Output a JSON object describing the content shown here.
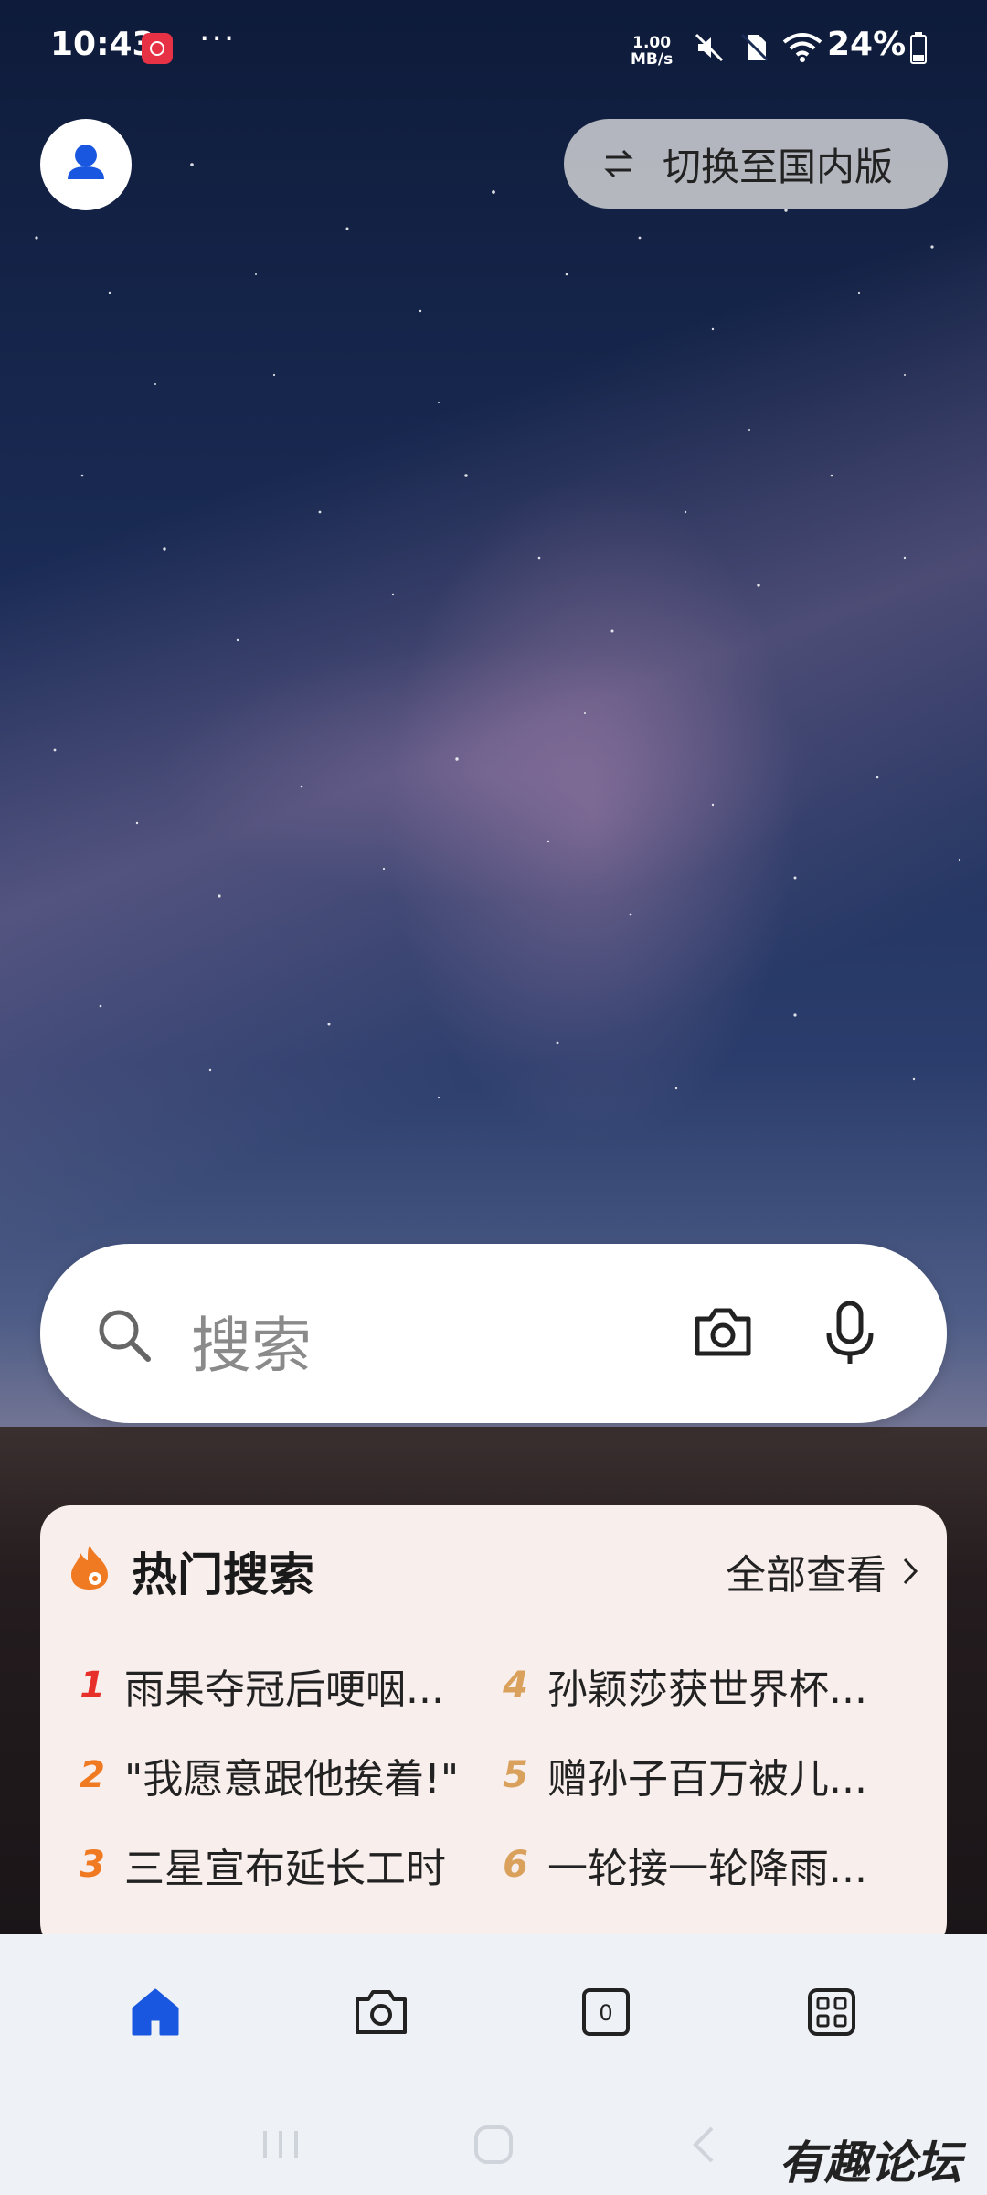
{
  "status_bar": {
    "time": "10:43",
    "net_speed_value": "1.00",
    "net_speed_unit": "MB/s",
    "battery_percent": "24%"
  },
  "top": {
    "switch_label": "切换至国内版"
  },
  "search": {
    "placeholder": "搜索"
  },
  "hot_search": {
    "title": "热门搜索",
    "view_all": "全部查看",
    "items": [
      {
        "rank": "1",
        "text": "雨果夺冠后哽咽..."
      },
      {
        "rank": "2",
        "text": "\"我愿意跟他挨着!\""
      },
      {
        "rank": "3",
        "text": "三星宣布延长工时"
      },
      {
        "rank": "4",
        "text": "孙颖莎获世界杯..."
      },
      {
        "rank": "5",
        "text": "赠孙子百万被儿..."
      },
      {
        "rank": "6",
        "text": "一轮接一轮降雨..."
      }
    ],
    "rank_colors": {
      "top": "#e8302a",
      "hot": "#f07a22",
      "normal": "#d9a15c"
    }
  },
  "bottom_nav": {
    "items": [
      {
        "name": "home",
        "active": true
      },
      {
        "name": "camera",
        "active": false
      },
      {
        "name": "tabs",
        "badge": "0",
        "active": false
      },
      {
        "name": "apps",
        "active": false
      }
    ],
    "active_color": "#1a57e0"
  },
  "watermark": "有趣论坛"
}
